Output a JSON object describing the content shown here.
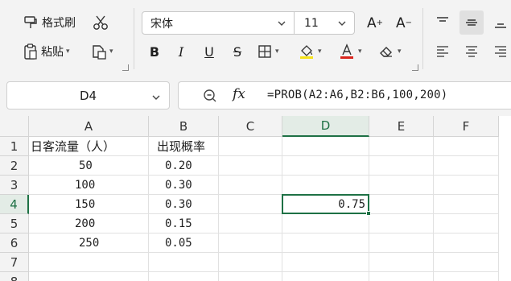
{
  "ribbon": {
    "format_painter_label": "格式刷",
    "paste_label": "粘贴",
    "font_name": "宋体",
    "font_size": "11",
    "bold_label": "B",
    "italic_label": "I",
    "underline_label": "U",
    "strike_label": "S",
    "grow_label": "A",
    "shrink_label": "A",
    "fill_color": "#f5e21a",
    "font_color": "#d9251d"
  },
  "namebox": {
    "value": "D4"
  },
  "formula": {
    "fx_label": "fx",
    "text": "=PROB(A2:A6,B2:B6,100,200)"
  },
  "accent_color": "#1e7145",
  "grid": {
    "columns": [
      "A",
      "B",
      "C",
      "D",
      "E",
      "F"
    ],
    "active_column": "D",
    "rows": [
      "1",
      "2",
      "3",
      "4",
      "5",
      "6",
      "7",
      "8"
    ],
    "active_row": "4",
    "cells": {
      "A1": "日客流量（人）",
      "B1": "出现概率",
      "A2": "50",
      "B2": "0.20",
      "A3": "100",
      "B3": "0.30",
      "A4": "150",
      "B4": "0.30",
      "A5": "200",
      "B5": "0.15",
      "A6": "250",
      "B6": "0.05",
      "D4": "0.75"
    }
  }
}
